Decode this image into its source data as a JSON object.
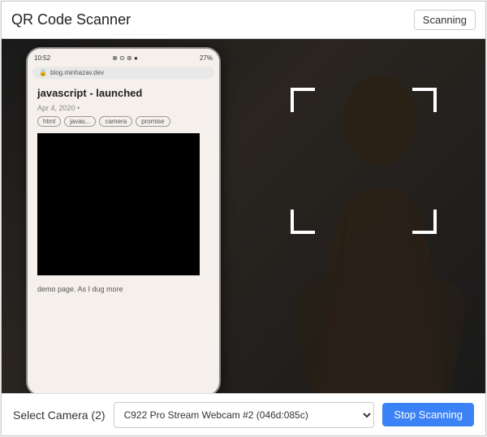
{
  "header": {
    "title": "QR Code Scanner",
    "scanning_badge": "Scanning"
  },
  "phone": {
    "status_time": "10:52",
    "status_icons": "⊕ ⊙ ⊛ •",
    "battery": "27%",
    "url": "blog.minhazav.dev",
    "article_title": "javascript - launched",
    "article_date": "Apr 4, 2020 •",
    "tags": [
      "html",
      "javas...",
      "camera",
      "promise"
    ],
    "footer_text": "demo page. As I dug more"
  },
  "footer": {
    "camera_label": "Select Camera (2)",
    "camera_option": "C922 Pro Stream Webcam #2 (046d:085c)",
    "stop_button": "Stop Scanning"
  }
}
